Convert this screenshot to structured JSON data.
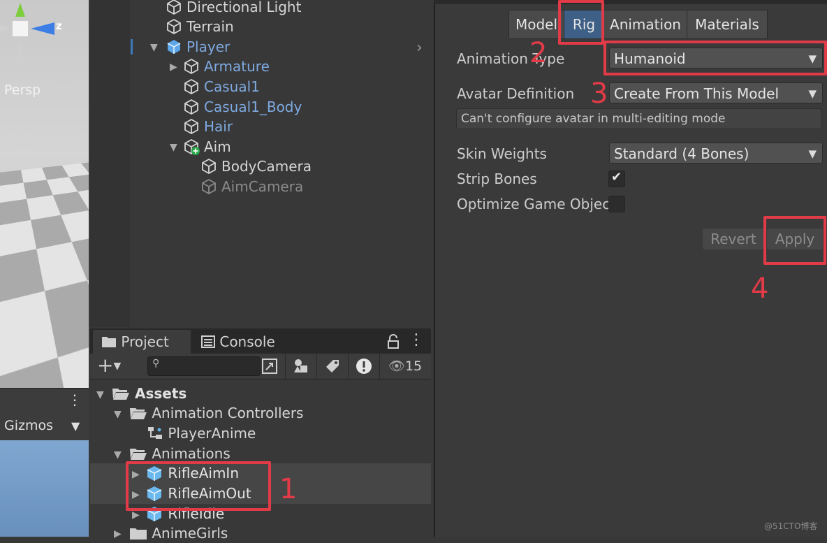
{
  "scene": {
    "view_label": "Persp",
    "axis_z": "z",
    "gizmos_label": "Gizmos"
  },
  "hierarchy": {
    "items": [
      {
        "label": "Directional Light"
      },
      {
        "label": "Terrain"
      },
      {
        "label": "Player"
      },
      {
        "label": "Armature"
      },
      {
        "label": "Casual1"
      },
      {
        "label": "Casual1_Body"
      },
      {
        "label": "Hair"
      },
      {
        "label": "Aim"
      },
      {
        "label": "BodyCamera"
      },
      {
        "label": "AimCamera"
      }
    ]
  },
  "project": {
    "tabs": [
      {
        "label": "Project"
      },
      {
        "label": "Console"
      }
    ],
    "visible_count": "15",
    "tree": [
      {
        "label": "Assets"
      },
      {
        "label": "Animation Controllers"
      },
      {
        "label": "PlayerAnime"
      },
      {
        "label": "Animations"
      },
      {
        "label": "RifleAimIn"
      },
      {
        "label": "RifleAimOut"
      },
      {
        "label": "RifleIdle"
      },
      {
        "label": "AnimeGirls"
      }
    ]
  },
  "inspector": {
    "tabs": [
      {
        "label": "Model"
      },
      {
        "label": "Rig"
      },
      {
        "label": "Animation"
      },
      {
        "label": "Materials"
      }
    ],
    "active_tab": "Rig",
    "animation_type": {
      "label": "Animation Type",
      "value": "Humanoid"
    },
    "avatar_definition": {
      "label": "Avatar Definition",
      "value": "Create From This Model"
    },
    "avatar_message": "Can't configure avatar in multi-editing mode",
    "skin_weights": {
      "label": "Skin Weights",
      "value": "Standard (4 Bones)"
    },
    "strip_bones": {
      "label": "Strip Bones",
      "checked": true
    },
    "optimize": {
      "label": "Optimize Game Objec",
      "checked": false
    },
    "revert_label": "Revert",
    "apply_label": "Apply"
  },
  "annotations": {
    "n1": "1",
    "n2": "2",
    "n3": "3",
    "n4": "4"
  },
  "watermark": "@51CTO博客",
  "colors": {
    "accent_red": "#e23b48",
    "selection_blue": "#3e5f86",
    "prefab_blue": "#7ea9e0"
  }
}
